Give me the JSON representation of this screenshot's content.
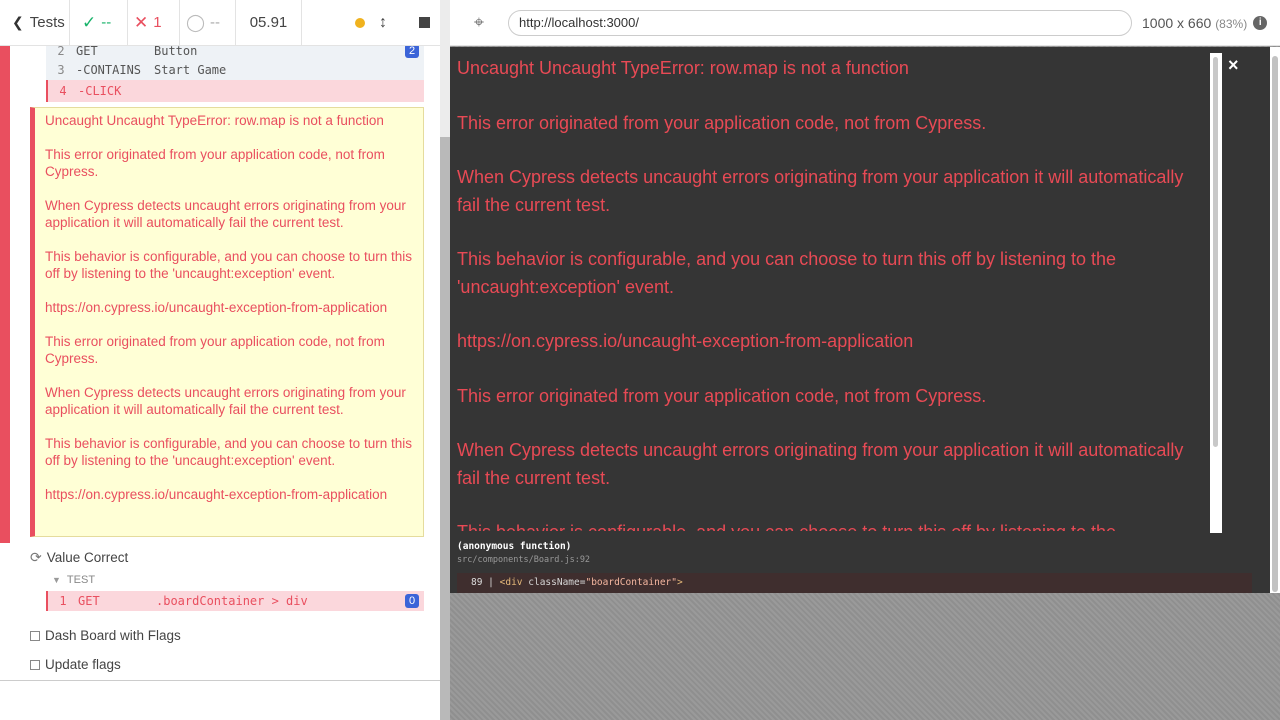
{
  "reporter": {
    "header": {
      "tests_label": "Tests",
      "passed": "--",
      "failed": "1",
      "pending": "--",
      "duration": "05.91"
    },
    "commands": [
      {
        "num": "2",
        "name": "GET",
        "message": "Button",
        "badge": "2"
      },
      {
        "num": "3",
        "name": "-CONTAINS",
        "message": "Start Game"
      },
      {
        "num": "4",
        "name": "-CLICK",
        "message": ""
      }
    ],
    "error_paragraphs": [
      "Uncaught Uncaught TypeError: row.map is not a function",
      "This error originated from your application code, not from Cypress.",
      "When Cypress detects uncaught errors originating from your application it will automatically fail the current test.",
      "This behavior is configurable, and you can choose to turn this off by listening to the 'uncaught:exception' event.",
      "https://on.cypress.io/uncaught-exception-from-application",
      "This error originated from your application code, not from Cypress.",
      "When Cypress detects uncaught errors originating from your application it will automatically fail the current test.",
      "This behavior is configurable, and you can choose to turn this off by listening to the 'uncaught:exception' event.",
      "https://on.cypress.io/uncaught-exception-from-application"
    ],
    "test_value_correct": "Value Correct",
    "test_section_label": "TEST",
    "get_command": {
      "num": "1",
      "name": "GET",
      "message": ".boardContainer > div",
      "badge": "0"
    },
    "test_dash_board": "Dash Board with Flags",
    "test_update_flags": "Update flags"
  },
  "preview": {
    "url": "http://localhost:3000/",
    "viewport": "1000 x 660",
    "zoom": "(83%)",
    "overlay_paragraphs": [
      "Uncaught Uncaught TypeError: row.map is not a function",
      "This error originated from your application code, not from Cypress.",
      "When Cypress detects uncaught errors originating from your application it will automatically fail the current test.",
      "This behavior is configurable, and you can choose to turn this off by listening to the 'uncaught:exception' event.",
      "https://on.cypress.io/uncaught-exception-from-application",
      "This error originated from your application code, not from Cypress.",
      "When Cypress detects uncaught errors originating from your application it will automatically fail the current test.",
      "This behavior is configurable, and you can choose to turn this off by listening to the"
    ],
    "close_label": "×",
    "stack_function": "(anonymous function)",
    "stack_file": "src/components/Board.js:92",
    "code_line_num": "89",
    "code_line_open": "<div",
    "code_line_attr": "className",
    "code_line_value": "\"boardContainer\"",
    "code_line_close": ">"
  },
  "colors": {
    "fail_red": "#e94f5f",
    "pass_green": "#19b36b",
    "overlay_bg": "#353535",
    "overlay_text": "#e84a55",
    "error_box_bg": "#ffffd6",
    "badge_blue": "#3b64d8"
  }
}
